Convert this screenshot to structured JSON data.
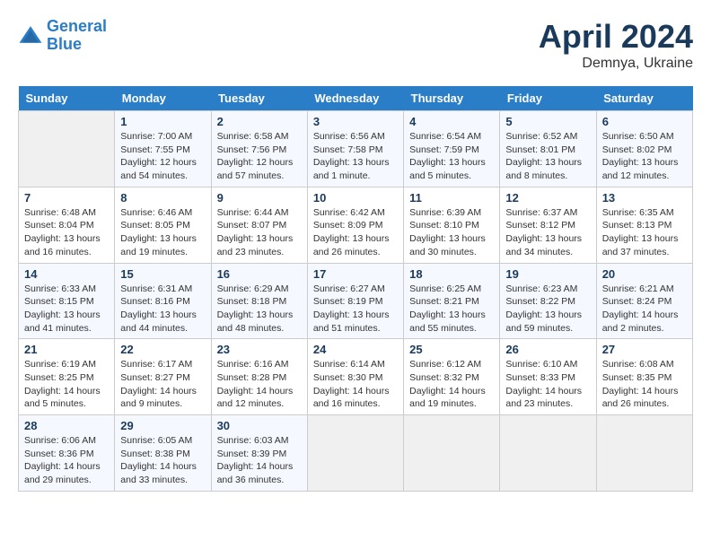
{
  "app": {
    "name": "GeneralBlue",
    "logo_text_1": "General",
    "logo_text_2": "Blue"
  },
  "calendar": {
    "month": "April 2024",
    "location": "Demnya, Ukraine",
    "days_of_week": [
      "Sunday",
      "Monday",
      "Tuesday",
      "Wednesday",
      "Thursday",
      "Friday",
      "Saturday"
    ],
    "weeks": [
      [
        {
          "day": "",
          "info": ""
        },
        {
          "day": "1",
          "info": "Sunrise: 7:00 AM\nSunset: 7:55 PM\nDaylight: 12 hours\nand 54 minutes."
        },
        {
          "day": "2",
          "info": "Sunrise: 6:58 AM\nSunset: 7:56 PM\nDaylight: 12 hours\nand 57 minutes."
        },
        {
          "day": "3",
          "info": "Sunrise: 6:56 AM\nSunset: 7:58 PM\nDaylight: 13 hours\nand 1 minute."
        },
        {
          "day": "4",
          "info": "Sunrise: 6:54 AM\nSunset: 7:59 PM\nDaylight: 13 hours\nand 5 minutes."
        },
        {
          "day": "5",
          "info": "Sunrise: 6:52 AM\nSunset: 8:01 PM\nDaylight: 13 hours\nand 8 minutes."
        },
        {
          "day": "6",
          "info": "Sunrise: 6:50 AM\nSunset: 8:02 PM\nDaylight: 13 hours\nand 12 minutes."
        }
      ],
      [
        {
          "day": "7",
          "info": "Sunrise: 6:48 AM\nSunset: 8:04 PM\nDaylight: 13 hours\nand 16 minutes."
        },
        {
          "day": "8",
          "info": "Sunrise: 6:46 AM\nSunset: 8:05 PM\nDaylight: 13 hours\nand 19 minutes."
        },
        {
          "day": "9",
          "info": "Sunrise: 6:44 AM\nSunset: 8:07 PM\nDaylight: 13 hours\nand 23 minutes."
        },
        {
          "day": "10",
          "info": "Sunrise: 6:42 AM\nSunset: 8:09 PM\nDaylight: 13 hours\nand 26 minutes."
        },
        {
          "day": "11",
          "info": "Sunrise: 6:39 AM\nSunset: 8:10 PM\nDaylight: 13 hours\nand 30 minutes."
        },
        {
          "day": "12",
          "info": "Sunrise: 6:37 AM\nSunset: 8:12 PM\nDaylight: 13 hours\nand 34 minutes."
        },
        {
          "day": "13",
          "info": "Sunrise: 6:35 AM\nSunset: 8:13 PM\nDaylight: 13 hours\nand 37 minutes."
        }
      ],
      [
        {
          "day": "14",
          "info": "Sunrise: 6:33 AM\nSunset: 8:15 PM\nDaylight: 13 hours\nand 41 minutes."
        },
        {
          "day": "15",
          "info": "Sunrise: 6:31 AM\nSunset: 8:16 PM\nDaylight: 13 hours\nand 44 minutes."
        },
        {
          "day": "16",
          "info": "Sunrise: 6:29 AM\nSunset: 8:18 PM\nDaylight: 13 hours\nand 48 minutes."
        },
        {
          "day": "17",
          "info": "Sunrise: 6:27 AM\nSunset: 8:19 PM\nDaylight: 13 hours\nand 51 minutes."
        },
        {
          "day": "18",
          "info": "Sunrise: 6:25 AM\nSunset: 8:21 PM\nDaylight: 13 hours\nand 55 minutes."
        },
        {
          "day": "19",
          "info": "Sunrise: 6:23 AM\nSunset: 8:22 PM\nDaylight: 13 hours\nand 59 minutes."
        },
        {
          "day": "20",
          "info": "Sunrise: 6:21 AM\nSunset: 8:24 PM\nDaylight: 14 hours\nand 2 minutes."
        }
      ],
      [
        {
          "day": "21",
          "info": "Sunrise: 6:19 AM\nSunset: 8:25 PM\nDaylight: 14 hours\nand 5 minutes."
        },
        {
          "day": "22",
          "info": "Sunrise: 6:17 AM\nSunset: 8:27 PM\nDaylight: 14 hours\nand 9 minutes."
        },
        {
          "day": "23",
          "info": "Sunrise: 6:16 AM\nSunset: 8:28 PM\nDaylight: 14 hours\nand 12 minutes."
        },
        {
          "day": "24",
          "info": "Sunrise: 6:14 AM\nSunset: 8:30 PM\nDaylight: 14 hours\nand 16 minutes."
        },
        {
          "day": "25",
          "info": "Sunrise: 6:12 AM\nSunset: 8:32 PM\nDaylight: 14 hours\nand 19 minutes."
        },
        {
          "day": "26",
          "info": "Sunrise: 6:10 AM\nSunset: 8:33 PM\nDaylight: 14 hours\nand 23 minutes."
        },
        {
          "day": "27",
          "info": "Sunrise: 6:08 AM\nSunset: 8:35 PM\nDaylight: 14 hours\nand 26 minutes."
        }
      ],
      [
        {
          "day": "28",
          "info": "Sunrise: 6:06 AM\nSunset: 8:36 PM\nDaylight: 14 hours\nand 29 minutes."
        },
        {
          "day": "29",
          "info": "Sunrise: 6:05 AM\nSunset: 8:38 PM\nDaylight: 14 hours\nand 33 minutes."
        },
        {
          "day": "30",
          "info": "Sunrise: 6:03 AM\nSunset: 8:39 PM\nDaylight: 14 hours\nand 36 minutes."
        },
        {
          "day": "",
          "info": ""
        },
        {
          "day": "",
          "info": ""
        },
        {
          "day": "",
          "info": ""
        },
        {
          "day": "",
          "info": ""
        }
      ]
    ]
  }
}
